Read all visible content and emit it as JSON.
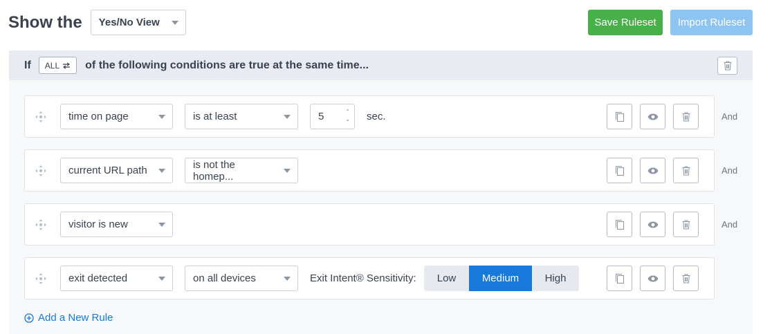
{
  "header": {
    "prefix": "Show the",
    "view_select": "Yes/No View",
    "save_label": "Save Ruleset",
    "import_label": "Import Ruleset"
  },
  "condition_bar": {
    "if_label": "If",
    "all_toggle": "ALL",
    "suffix": "of the following conditions are true at the same time..."
  },
  "rules": [
    {
      "field": "time on page",
      "operator": "is at least",
      "value": "5",
      "unit": "sec.",
      "join": "And"
    },
    {
      "field": "current URL path",
      "operator": "is not the homep...",
      "join": "And"
    },
    {
      "field": "visitor is new",
      "join": "And"
    },
    {
      "field": "exit detected",
      "operator": "on all devices",
      "sensitivity_label": "Exit Intent® Sensitivity:",
      "sensitivity_options": [
        "Low",
        "Medium",
        "High"
      ],
      "sensitivity_selected": "Medium"
    }
  ],
  "add_rule_label": "Add a New Rule",
  "colors": {
    "accent": "#1779d9",
    "save": "#47b049",
    "import": "#8dc4f2"
  },
  "icons": [
    "swap-icon",
    "trash-icon",
    "drag-handle-icon",
    "copy-icon",
    "eye-icon",
    "plus-circle-icon",
    "caret-down-icon"
  ]
}
